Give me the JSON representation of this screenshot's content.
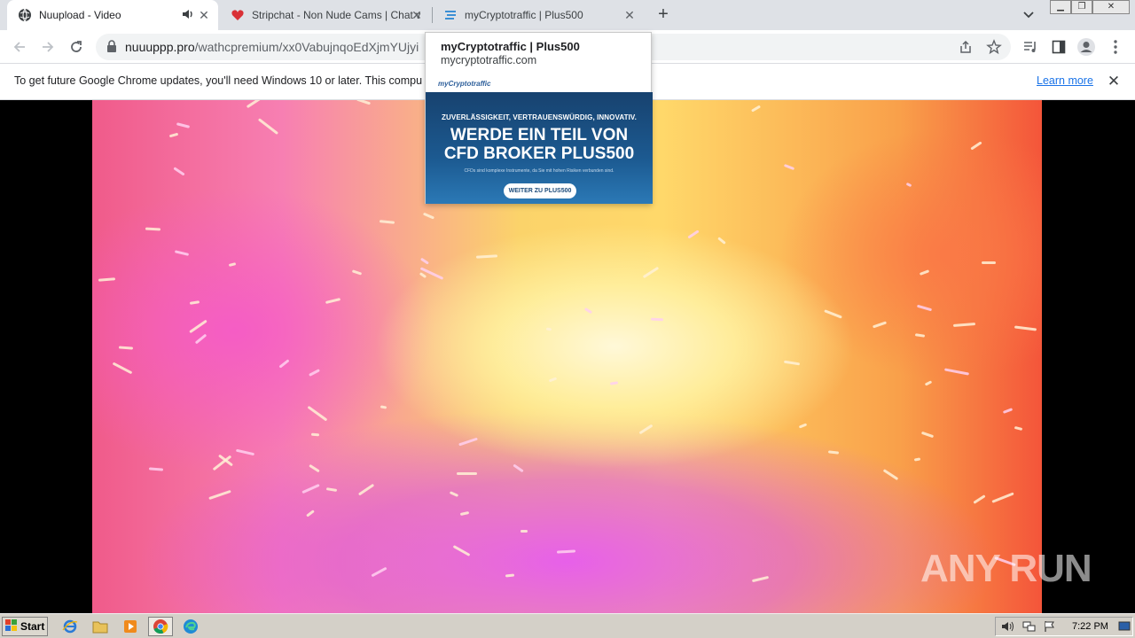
{
  "browser": {
    "tabs": [
      {
        "title": "Nuupload - Video",
        "favicon": "globe-icon",
        "audio": true,
        "active": true
      },
      {
        "title": "Stripchat - Non Nude Cams | Chat wi",
        "favicon": "heart-icon",
        "active": false
      },
      {
        "title": "myCryptotraffic | Plus500",
        "favicon": "crypto-logo-icon",
        "active": false
      }
    ],
    "new_tab_label": "+",
    "url_host": "nuuuppp.pro",
    "url_path": "/wathcpremium/xx0VabujnqoEdXjmYUjyi"
  },
  "infobar": {
    "text": "To get future Google Chrome updates, you'll need Windows 10 or later. This compu",
    "link": "Learn more"
  },
  "hovercard": {
    "title": "myCryptotraffic | Plus500",
    "domain": "mycryptotraffic.com",
    "logo_text": "myCryptotraffic",
    "ad": {
      "tagline": "ZUVERLÄSSIGKEIT, VERTRAUENSWÜRDIG, INNOVATIV.",
      "headline1": "WERDE EIN TEIL VON",
      "headline2": "CFD BROKER PLUS500",
      "smallprint": "CFDs sind komplexe Instrumente, da Sie mit hohen Risiken verbunden sind.",
      "cta": "WEITER ZU PLUS500"
    }
  },
  "watermark": "ANY RUN",
  "taskbar": {
    "start_label": "Start",
    "clock": "7:22 PM"
  },
  "colors": {
    "tab_strip": "#dee1e6",
    "link": "#1a73e8",
    "ad_bg": "#1c5a91"
  }
}
